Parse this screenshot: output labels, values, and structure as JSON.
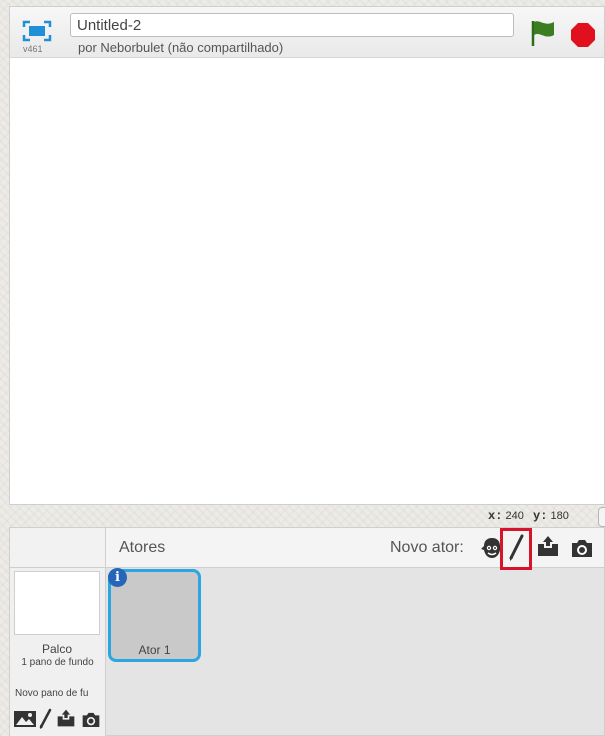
{
  "header": {
    "title_value": "Untitled-2",
    "author_text": "por Neborbulet (não compartilhado)",
    "version": "v461",
    "fullscreen_icon": "fullscreen-icon",
    "flag_icon": "green-flag-icon",
    "stop_icon": "stop-icon",
    "colors": {
      "flag": "#3a7d22",
      "stop": "#e0101f",
      "fullscreen": "#1f8fd8"
    }
  },
  "coords": {
    "x_label": "x:",
    "x_value": "240",
    "y_label": "y:",
    "y_value": "180"
  },
  "sprites_panel": {
    "title": "Atores",
    "new_sprite_label": "Novo ator:",
    "new_sprite_icons": [
      "sprite-library-icon",
      "paintbrush-icon",
      "upload-icon",
      "camera-icon"
    ],
    "highlight_color": "#d6142c",
    "sprites": [
      {
        "name": "Ator 1",
        "info_icon": "info-icon",
        "info_glyph": "i"
      }
    ]
  },
  "stage_panel": {
    "name": "Palco",
    "backdrop_count": "1 pano de fundo",
    "new_backdrop_label": "Novo pano de fu",
    "new_backdrop_icons": [
      "backdrop-library-icon",
      "paintbrush-icon",
      "upload-icon",
      "camera-icon"
    ]
  }
}
